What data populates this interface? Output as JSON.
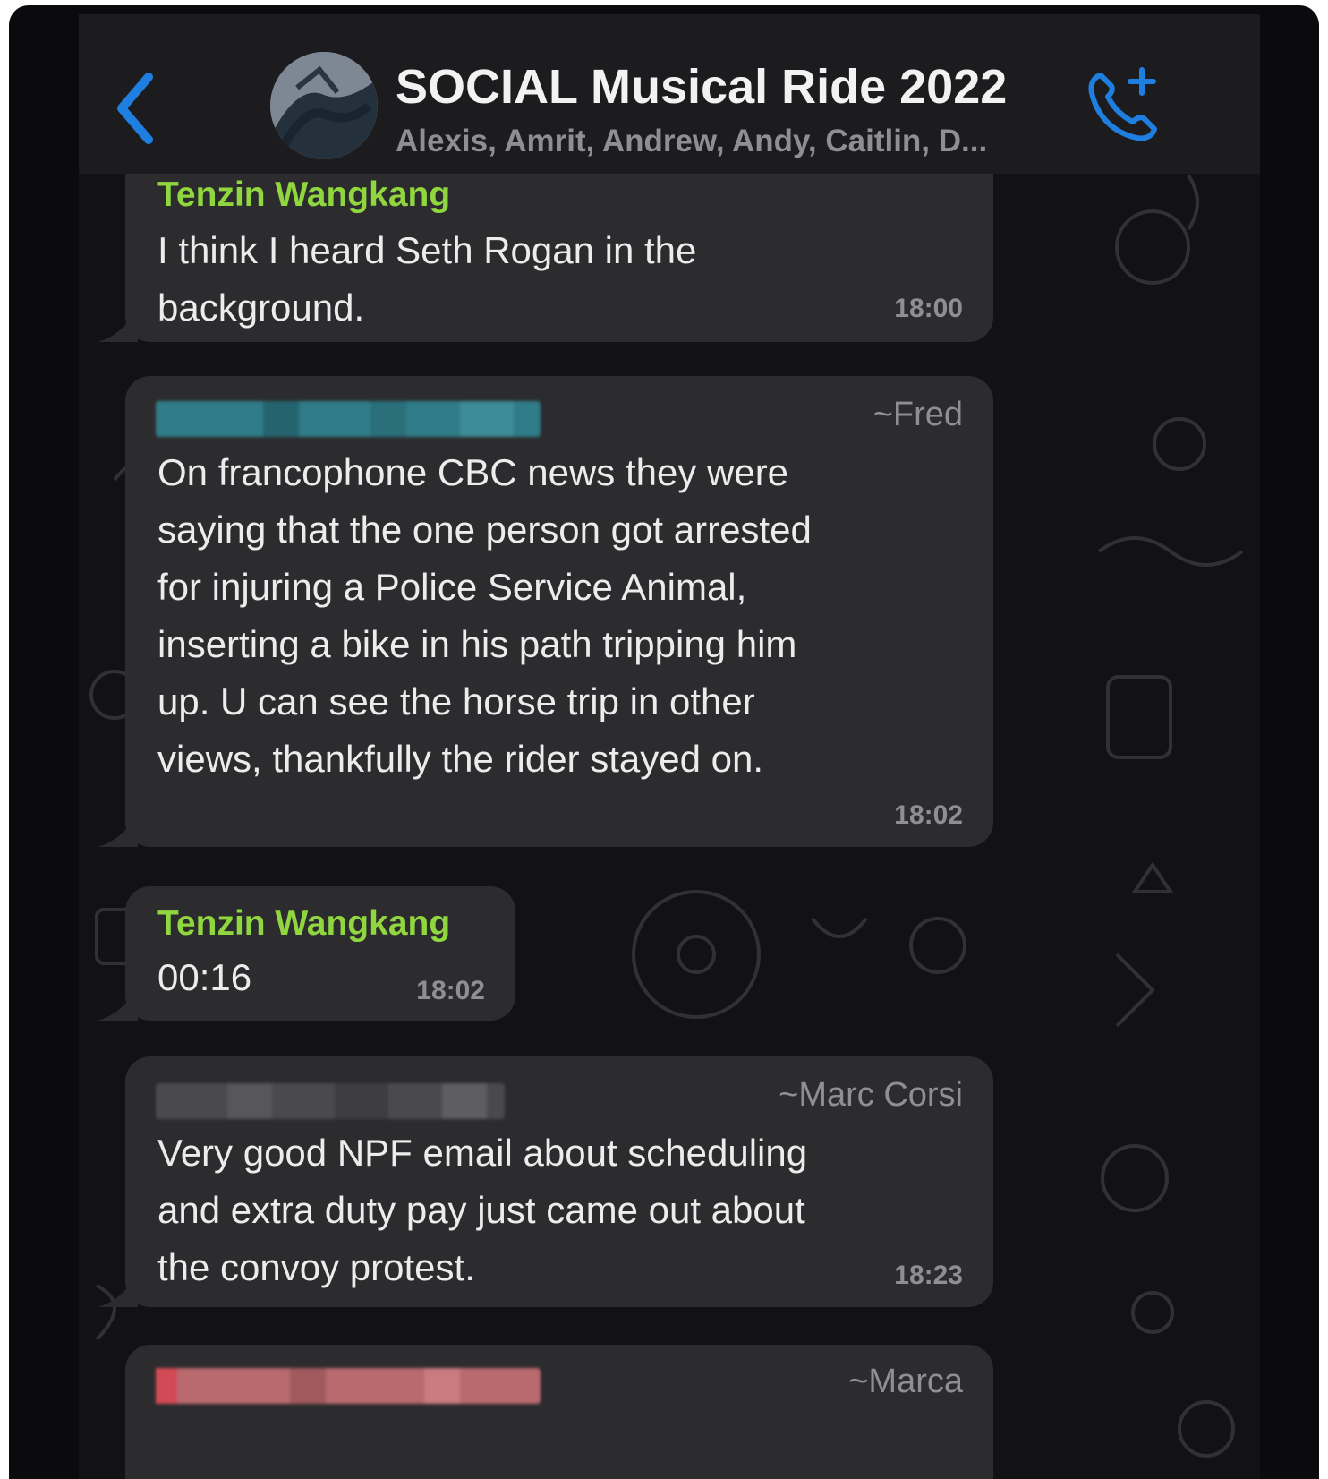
{
  "header": {
    "title": "SOCIAL Musical Ride 2022",
    "participants": "Alexis, Amrit, Andrew, Andy, Caitlin, D..."
  },
  "icons": {
    "back": "chevron-left-icon",
    "avatar": "group-avatar",
    "call": "add-call-icon"
  },
  "colors": {
    "accent": "#1f7fe0",
    "sender_name": "#8fd63f",
    "bubble": "#2c2c2e",
    "background": "#121214"
  },
  "messages": [
    {
      "sender": "Tenzin Wangkang",
      "lines": [
        "I think I heard Seth Rogan in the",
        "background."
      ],
      "time": "18:00"
    },
    {
      "author": "~Fred",
      "lines": [
        "On francophone CBC news they were",
        "saying that the one person got arrested",
        "for injuring a Police Service Animal,",
        "inserting a bike in his path tripping him",
        "up.  U can see the horse trip in other",
        "views, thankfully the rider stayed on."
      ],
      "time": "18:02"
    },
    {
      "sender": "Tenzin Wangkang",
      "lines": [
        "00:16"
      ],
      "time": "18:02"
    },
    {
      "author": "~Marc Corsi",
      "lines": [
        "Very good NPF email about scheduling",
        "and extra duty pay just came out about",
        "the convoy protest."
      ],
      "time": "18:23"
    },
    {
      "author": "~Marca"
    }
  ]
}
